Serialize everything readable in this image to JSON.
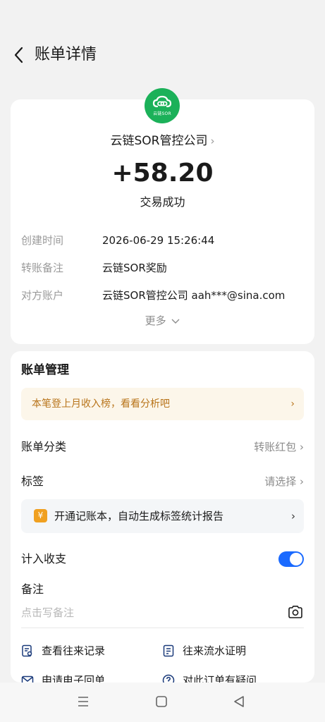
{
  "header": {
    "title": "账单详情"
  },
  "summary": {
    "logo_text": "云链SOR",
    "payee": "云链SOR管控公司",
    "amount": "+58.20",
    "status": "交易成功"
  },
  "details": [
    {
      "label": "创建时间",
      "value": "2026-06-29 15:26:44"
    },
    {
      "label": "转账备注",
      "value": "云链SOR奖励"
    },
    {
      "label": "对方账户",
      "value": "云链SOR管控公司 aah***@sina.com"
    }
  ],
  "more_label": "更多",
  "management": {
    "title": "账单管理",
    "banner_text": "本笔登上月收入榜，看看分析吧",
    "category_label": "账单分类",
    "category_value": "转账红包",
    "tag_label": "标签",
    "tag_value": "请选择",
    "promo_icon": "¥",
    "promo_text": "开通记账本，自动生成标签统计报告",
    "include_label": "计入收支",
    "include_enabled": true,
    "note_label": "备注",
    "note_placeholder": "点击写备注"
  },
  "links": {
    "history": "查看往来记录",
    "statement": "往来流水证明",
    "receipt": "申请电子回单",
    "question": "对此订单有疑问"
  },
  "colors": {
    "accent": "#1a6aff",
    "logo_green": "#1bb159",
    "banner_text": "#b8741a",
    "banner_bg": "#fcf6ea"
  }
}
